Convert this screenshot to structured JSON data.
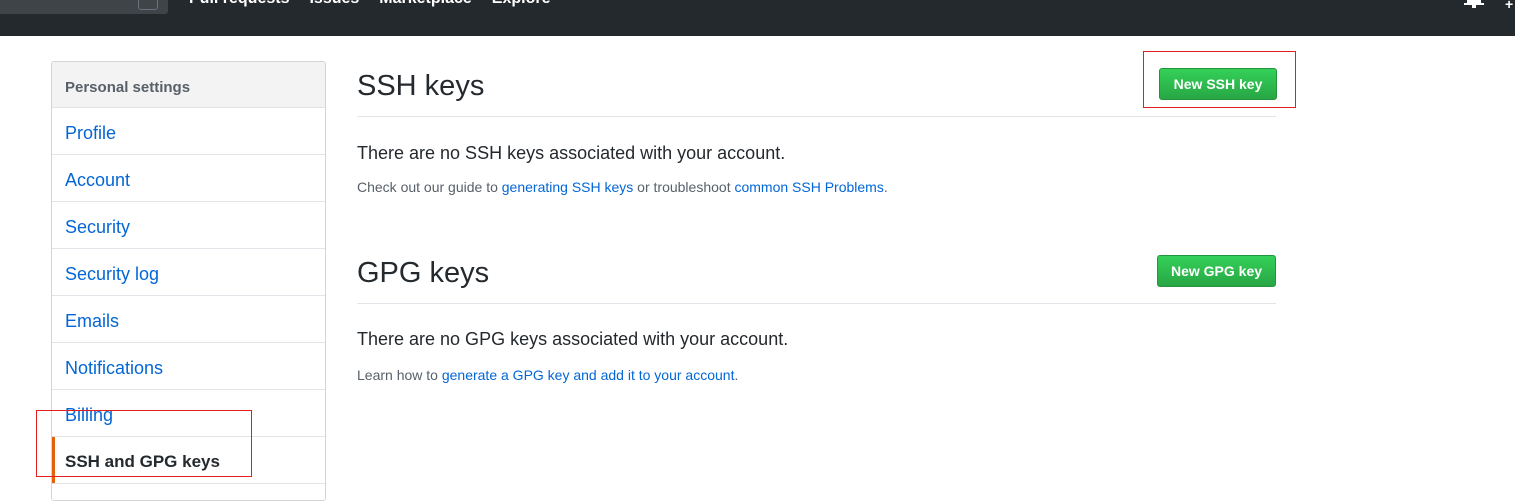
{
  "header": {
    "nav": [
      "Pull requests",
      "Issues",
      "Marketplace",
      "Explore"
    ],
    "plus_glyph": "+",
    "icons": [
      "bell-icon",
      "plus-icon"
    ]
  },
  "sidebar": {
    "header": "Personal settings",
    "items": [
      {
        "label": "Profile",
        "selected": false
      },
      {
        "label": "Account",
        "selected": false
      },
      {
        "label": "Security",
        "selected": false
      },
      {
        "label": "Security log",
        "selected": false
      },
      {
        "label": "Emails",
        "selected": false
      },
      {
        "label": "Notifications",
        "selected": false
      },
      {
        "label": "Billing",
        "selected": false
      },
      {
        "label": "SSH and GPG keys",
        "selected": true
      }
    ]
  },
  "ssh": {
    "title": "SSH keys",
    "button": "New SSH key",
    "empty": "There are no SSH keys associated with your account.",
    "help_prefix": "Check out our guide to ",
    "help_link1": "generating SSH keys",
    "help_middle": " or troubleshoot ",
    "help_link2": "common SSH Problems",
    "help_suffix": "."
  },
  "gpg": {
    "title": "GPG keys",
    "button": "New GPG key",
    "empty": "There are no GPG keys associated with your account.",
    "help_prefix": "Learn how to ",
    "help_link": "generate a GPG key and add it to your account",
    "help_suffix": "."
  },
  "colors": {
    "topbar": "#24292e",
    "link": "#0366d6",
    "button_green": "#28a745",
    "selected_accent": "#e36209",
    "annotation_red": "#e21e1e"
  }
}
